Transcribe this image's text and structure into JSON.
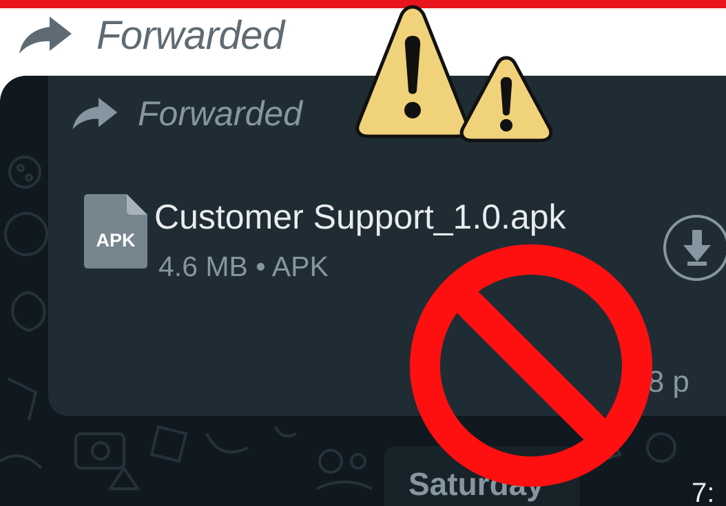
{
  "header": {
    "forward_label": "Forwarded",
    "bar_color": "#e8141b"
  },
  "message": {
    "forward_label": "Forwarded",
    "file": {
      "icon_label": "APK",
      "name": "Customer Support_1.0.apk",
      "meta": "4.6 MB • APK"
    },
    "download_icon": "download-arrow-icon",
    "timestamp": ":38 p"
  },
  "date_divider": {
    "label": "Saturday"
  },
  "bottom_time": "7:",
  "overlays": {
    "warning_icon": "warning-triangle-icon",
    "prohibition_icon": "no-entry-icon",
    "warning_color": "#f0d27a",
    "prohibition_color": "#ff1010"
  },
  "colors": {
    "chat_background": "#10191f",
    "bubble": "#1f2c34",
    "primary_text": "#e9edef",
    "secondary_text": "#8696a0"
  }
}
